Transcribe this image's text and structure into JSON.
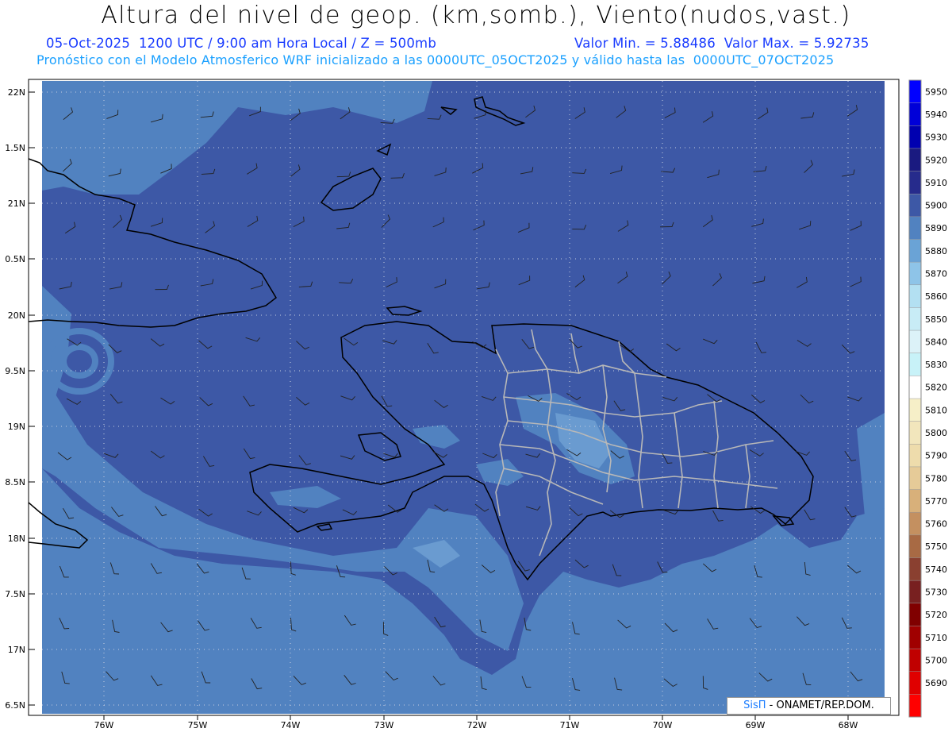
{
  "header": {
    "title": "Altura del nivel de geop. (km,somb.), Viento(nudos,vast.)",
    "date_time": "05-Oct-2025  1200 UTC / 9:00 am Hora Local / Z = 500mb",
    "min_max": "Valor Min. = 5.88486  Valor Max. = 5.92735",
    "forecast_info": "Pronóstico con el Modelo Atmosferico WRF inicializado a las 0000UTC_05OCT2025 y válido hasta las  0000UTC_07OCT2025"
  },
  "map": {
    "lat_labels": [
      "22N",
      "1.5N",
      "21N",
      "0.5N",
      "20N",
      "9.5N",
      "19N",
      "8.5N",
      "18N",
      "7.5N",
      "17N",
      "6.5N"
    ],
    "lon_labels": [
      "76W",
      "75W",
      "74W",
      "73W",
      "72W",
      "71W",
      "70W",
      "69W",
      "68W"
    ],
    "colors": {
      "deep_blue": "#3d58a6",
      "medium_blue": "#5182c0",
      "light_blue": "#6a9bd0",
      "land_border": "#000000",
      "province_border": "#b8b8b8",
      "grid_dots": "#c8cfe0"
    }
  },
  "colorbar": {
    "levels": [
      "5950",
      "5940",
      "5930",
      "5920",
      "5910",
      "5900",
      "5890",
      "5880",
      "5870",
      "5860",
      "5850",
      "5840",
      "5830",
      "5820",
      "5810",
      "5800",
      "5790",
      "5780",
      "5770",
      "5760",
      "5750",
      "5740",
      "5730",
      "5720",
      "5710",
      "5700",
      "5690"
    ],
    "colors": [
      "#0000ff",
      "#0000d8",
      "#0000b0",
      "#1a1a80",
      "#262b8c",
      "#3d58a6",
      "#5182c0",
      "#6aa3d6",
      "#8ec4e8",
      "#b3e0f2",
      "#c8ecf6",
      "#dcf2f8",
      "#c8f2f8",
      "#ffffff",
      "#f6efc8",
      "#f2e6bc",
      "#eedcac",
      "#e6cb98",
      "#d8b07a",
      "#c49060",
      "#a86a44",
      "#8a4030",
      "#782020",
      "#800000",
      "#a00000",
      "#c00000",
      "#e00000",
      "#ff0000"
    ]
  },
  "credit": {
    "brand": "SisΠ",
    "label": " - ONAMET/REP.DOM."
  }
}
